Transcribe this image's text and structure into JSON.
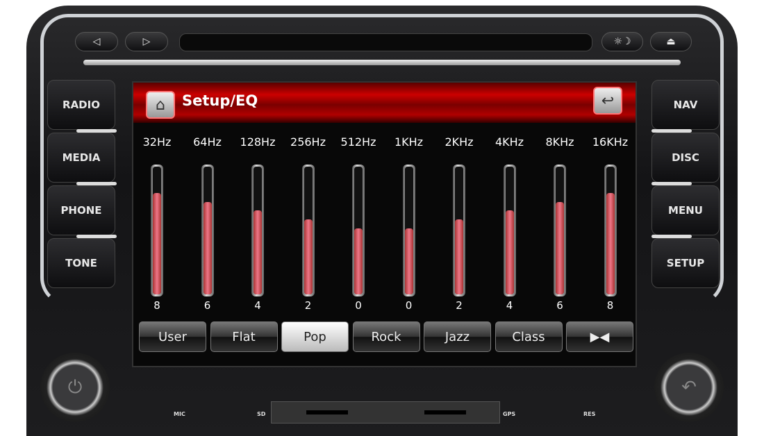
{
  "device": {
    "top_buttons": [
      {
        "icon": "prev-icon",
        "glyph": "◁"
      },
      {
        "icon": "next-icon",
        "glyph": "▷"
      },
      {
        "icon": "brightness-icon",
        "glyph": "☼☽"
      },
      {
        "icon": "eject-icon",
        "glyph": "⏏"
      }
    ],
    "left_buttons": [
      "RADIO",
      "MEDIA",
      "PHONE",
      "TONE"
    ],
    "right_buttons": [
      "NAV",
      "DISC",
      "MENU",
      "SETUP"
    ],
    "labels": {
      "mic": "MIC",
      "sd": "SD",
      "gps": "GPS",
      "res": "RES"
    }
  },
  "screen": {
    "title": "Setup/EQ",
    "home_icon": "home-icon",
    "back_icon": "back-icon",
    "bands": [
      {
        "freq": "32Hz",
        "value": 8
      },
      {
        "freq": "64Hz",
        "value": 6
      },
      {
        "freq": "128Hz",
        "value": 4
      },
      {
        "freq": "256Hz",
        "value": 2
      },
      {
        "freq": "512Hz",
        "value": 0
      },
      {
        "freq": "1KHz",
        "value": 0
      },
      {
        "freq": "2KHz",
        "value": 2
      },
      {
        "freq": "4KHz",
        "value": 4
      },
      {
        "freq": "8KHz",
        "value": 6
      },
      {
        "freq": "16KHz",
        "value": 8
      }
    ],
    "presets": [
      {
        "label": "User"
      },
      {
        "label": "Flat"
      },
      {
        "label": "Pop",
        "active": true
      },
      {
        "label": "Rock"
      },
      {
        "label": "Jazz"
      },
      {
        "label": "Class"
      },
      {
        "label": "▶◀",
        "icon": "balance-icon"
      }
    ],
    "colors": {
      "titlebar": "#c00000",
      "fill": "#e06070"
    }
  }
}
